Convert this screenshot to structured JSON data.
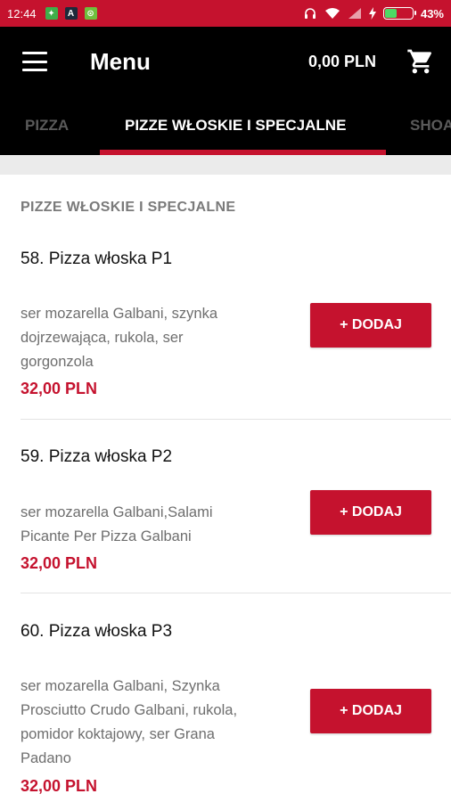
{
  "status_bar": {
    "time": "12:44",
    "battery_percent": "43%",
    "battery_level": 0.43,
    "icons": [
      "notification-green-icon",
      "notification-dark-icon",
      "notification-lime-icon",
      "headphones-icon",
      "wifi-icon",
      "signal-icon",
      "charging-icon",
      "battery-icon"
    ]
  },
  "app_bar": {
    "title": "Menu",
    "cart_total": "0,00 PLN",
    "menu_icon": "hamburger-icon",
    "cart_icon": "cart-icon"
  },
  "tabs": [
    {
      "label": "PIZZA",
      "active": false
    },
    {
      "label": "PIZZE WŁOSKIE I SPECJALNE",
      "active": true
    },
    {
      "label": "SHOA",
      "active": false
    }
  ],
  "section": {
    "title": "PIZZE WŁOSKIE I SPECJALNE"
  },
  "items": [
    {
      "name": "58. Pizza włoska P1",
      "desc_lines": [
        "ser mozarella Galbani, szynka",
        "dojrzewająca, rukola, ser",
        "gorgonzola"
      ],
      "price": "32,00 PLN",
      "button": "+ DODAJ"
    },
    {
      "name": "59. Pizza włoska P2",
      "desc_lines": [
        "ser mozarella Galbani,Salami",
        "Picante Per Pizza Galbani"
      ],
      "price": "32,00 PLN",
      "button": "+ DODAJ"
    },
    {
      "name": "60. Pizza włoska P3",
      "desc_lines": [
        "ser mozarella Galbani, Szynka",
        "Prosciutto Crudo Galbani, rukola,",
        "pomidor koktajowy, ser Grana",
        "Padano"
      ],
      "price": "32,00 PLN",
      "button": "+ DODAJ"
    }
  ],
  "colors": {
    "accent": "#c5122e",
    "app_bar": "#000000",
    "muted_text": "#6e6e6e"
  }
}
